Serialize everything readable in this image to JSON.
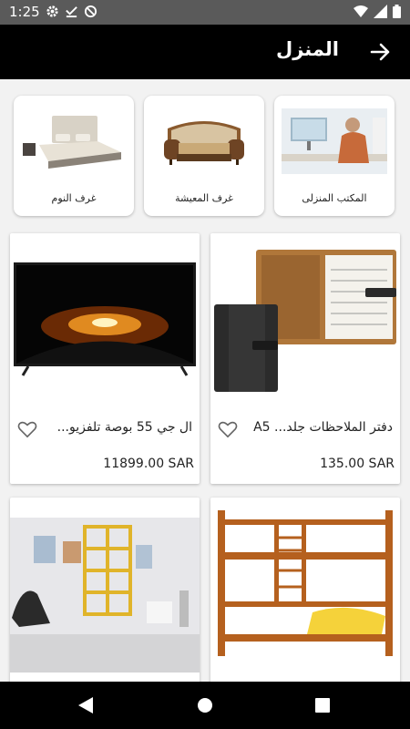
{
  "status": {
    "time": "1:25",
    "left_icons": [
      "gear-icon",
      "download-done-icon",
      "block-icon"
    ],
    "right_icons": [
      "wifi-icon",
      "signal-icon",
      "battery-icon"
    ]
  },
  "appbar": {
    "title": "المنزل",
    "back_icon": "arrow-right-icon"
  },
  "categories": [
    {
      "label": "المكتب المنزلى",
      "image": "home-office-photo"
    },
    {
      "label": "غرف المعيشة",
      "image": "sofa-photo"
    },
    {
      "label": "غرف النوم",
      "image": "bed-photo"
    }
  ],
  "products": [
    {
      "name": "دفتر الملاحظات جلد... A5",
      "price": "135.00 SAR",
      "image": "leather-notebook-photo"
    },
    {
      "name": "ال جي 55 بوصة تلفزيو...",
      "price": "11899.00 SAR",
      "image": "lg-tv-photo"
    },
    {
      "name": "",
      "price": "",
      "image": "bunk-bed-photo"
    },
    {
      "name": "",
      "price": "",
      "image": "living-room-shelf-photo"
    }
  ],
  "navbar": {
    "icons": [
      "back-triangle-icon",
      "home-circle-icon",
      "recents-square-icon"
    ]
  },
  "colors": {
    "appbar": "#000000",
    "statusbar": "#5a5a5a",
    "background": "#f2f2f2"
  }
}
